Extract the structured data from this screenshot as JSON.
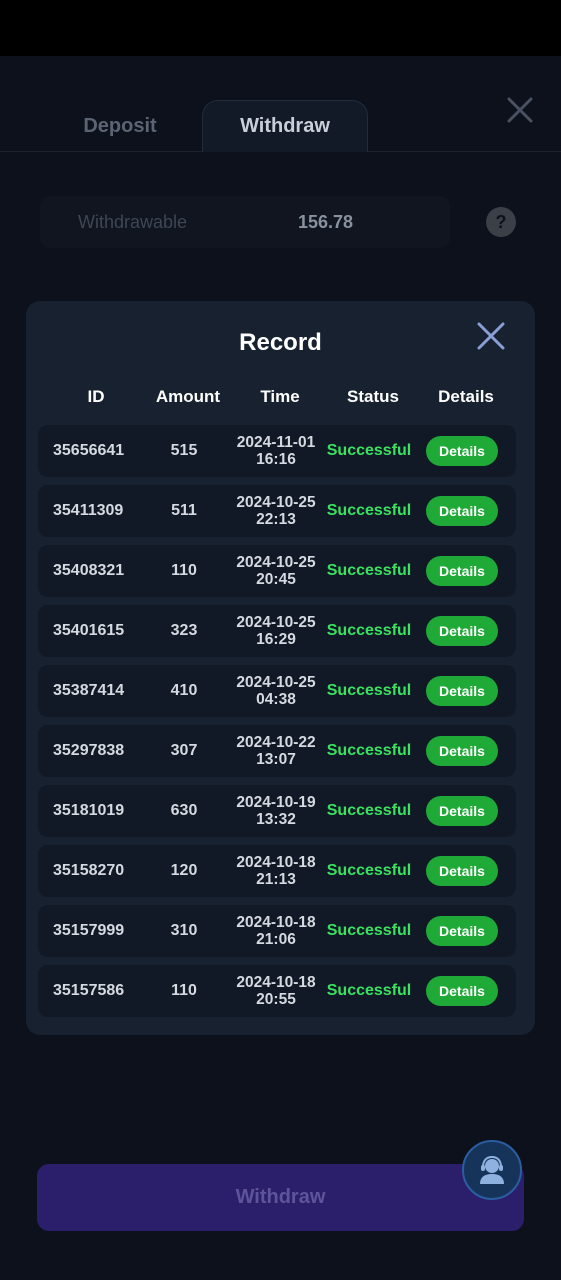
{
  "tabs": {
    "deposit": "Deposit",
    "withdraw": "Withdraw"
  },
  "balance": {
    "label": "Withdrawable",
    "value": "156.78"
  },
  "help_glyph": "?",
  "withdraw_button": "Withdraw",
  "modal": {
    "title": "Record",
    "columns": [
      "ID",
      "Amount",
      "Time",
      "Status",
      "Details"
    ],
    "records": [
      {
        "id": "35656641",
        "amount": "515",
        "date": "2024-11-01",
        "time": "16:16",
        "status": "Successful",
        "details": "Details"
      },
      {
        "id": "35411309",
        "amount": "511",
        "date": "2024-10-25",
        "time": "22:13",
        "status": "Successful",
        "details": "Details"
      },
      {
        "id": "35408321",
        "amount": "110",
        "date": "2024-10-25",
        "time": "20:45",
        "status": "Successful",
        "details": "Details"
      },
      {
        "id": "35401615",
        "amount": "323",
        "date": "2024-10-25",
        "time": "16:29",
        "status": "Successful",
        "details": "Details"
      },
      {
        "id": "35387414",
        "amount": "410",
        "date": "2024-10-25",
        "time": "04:38",
        "status": "Successful",
        "details": "Details"
      },
      {
        "id": "35297838",
        "amount": "307",
        "date": "2024-10-22",
        "time": "13:07",
        "status": "Successful",
        "details": "Details"
      },
      {
        "id": "35181019",
        "amount": "630",
        "date": "2024-10-19",
        "time": "13:32",
        "status": "Successful",
        "details": "Details"
      },
      {
        "id": "35158270",
        "amount": "120",
        "date": "2024-10-18",
        "time": "21:13",
        "status": "Successful",
        "details": "Details"
      },
      {
        "id": "35157999",
        "amount": "310",
        "date": "2024-10-18",
        "time": "21:06",
        "status": "Successful",
        "details": "Details"
      },
      {
        "id": "35157586",
        "amount": "110",
        "date": "2024-10-18",
        "time": "20:55",
        "status": "Successful",
        "details": "Details"
      }
    ]
  },
  "icons": {
    "page_close": "close-icon",
    "modal_close": "close-icon",
    "help": "help-icon",
    "support": "customer-support-icon"
  },
  "colors": {
    "status_success": "#3be15f",
    "details_button": "#1faa37",
    "withdraw_button": "#2b1f6b",
    "modal_bg": "#172130"
  }
}
